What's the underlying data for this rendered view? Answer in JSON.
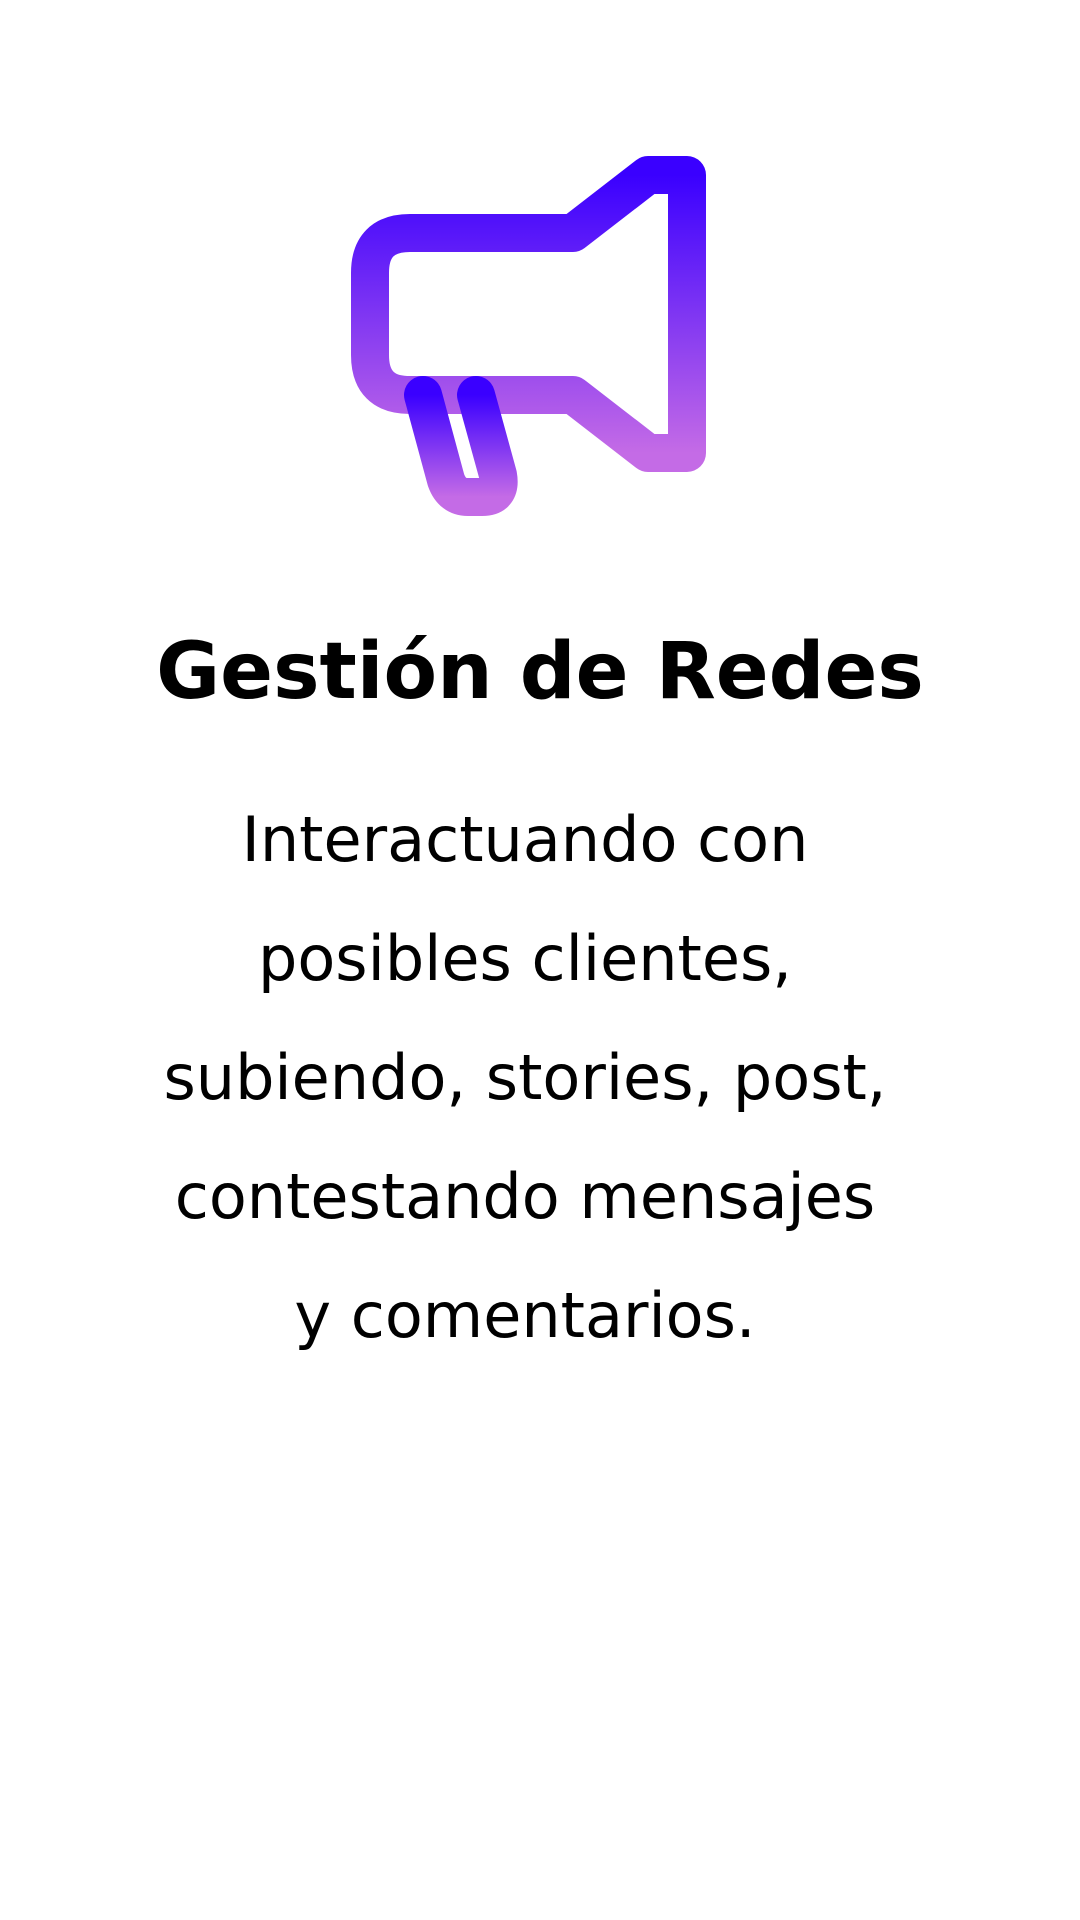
{
  "icon": {
    "name": "megaphone-icon",
    "gradient_start": "#3A00FF",
    "gradient_end": "#C46BE6"
  },
  "title": "Gestión de Redes",
  "description_lines": [
    "Interactuando con",
    "posibles clientes,",
    "subiendo, stories, post,",
    "contestando mensajes",
    "y comentarios."
  ]
}
